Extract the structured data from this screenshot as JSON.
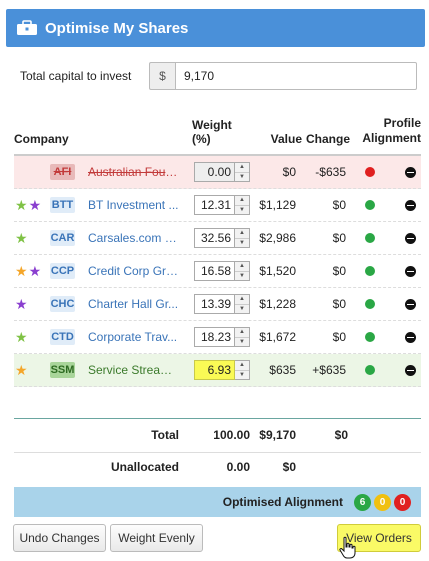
{
  "header": {
    "title": "Optimise My Shares"
  },
  "capital": {
    "label": "Total capital to invest",
    "prefix": "$",
    "value": "9,170"
  },
  "columns": {
    "company": "Company",
    "weight": "Weight (%)",
    "value": "Value",
    "change": "Change",
    "alignment_line1": "Profile",
    "alignment_line2": "Alignment"
  },
  "rows": [
    {
      "ticker": "AFI",
      "name": "Australian Foun...",
      "weight": "0.00",
      "value": "$0",
      "change": "-$635",
      "status": "removed",
      "alignment": "red",
      "stars": []
    },
    {
      "ticker": "BTT",
      "name": "BT Investment ...",
      "weight": "12.31",
      "value": "$1,129",
      "change": "$0",
      "status": "normal",
      "alignment": "green",
      "stars": [
        "green",
        "purple"
      ]
    },
    {
      "ticker": "CAR",
      "name": "Carsales.com Li...",
      "weight": "32.56",
      "value": "$2,986",
      "change": "$0",
      "status": "normal",
      "alignment": "green",
      "stars": [
        "green"
      ]
    },
    {
      "ticker": "CCP",
      "name": "Credit Corp Gro...",
      "weight": "16.58",
      "value": "$1,520",
      "change": "$0",
      "status": "normal",
      "alignment": "green",
      "stars": [
        "orange",
        "purple"
      ]
    },
    {
      "ticker": "CHC",
      "name": "Charter Hall Gr...",
      "weight": "13.39",
      "value": "$1,228",
      "change": "$0",
      "status": "normal",
      "alignment": "green",
      "stars": [
        "purple"
      ]
    },
    {
      "ticker": "CTD",
      "name": "Corporate Trav...",
      "weight": "18.23",
      "value": "$1,672",
      "change": "$0",
      "status": "normal",
      "alignment": "green",
      "stars": [
        "green"
      ]
    },
    {
      "ticker": "SSM",
      "name": "Service Stream ...",
      "weight": "6.93",
      "value": "$635",
      "change": "+$635",
      "status": "added",
      "alignment": "green",
      "stars": [
        "orange"
      ]
    }
  ],
  "totals": {
    "label": "Total",
    "weight": "100.00",
    "value": "$9,170",
    "change": "$0"
  },
  "unallocated": {
    "label": "Unallocated",
    "weight": "0.00",
    "value": "$0"
  },
  "optimised": {
    "label": "Optimised Alignment",
    "green": "6",
    "yellow": "0",
    "red": "0"
  },
  "buttons": {
    "undo": "Undo Changes",
    "even": "Weight Evenly",
    "orders": "View Orders"
  },
  "colors": {
    "header": "#4a90d9",
    "accent_yellow": "#fafa66",
    "align_bar": "#a9d3ea"
  }
}
